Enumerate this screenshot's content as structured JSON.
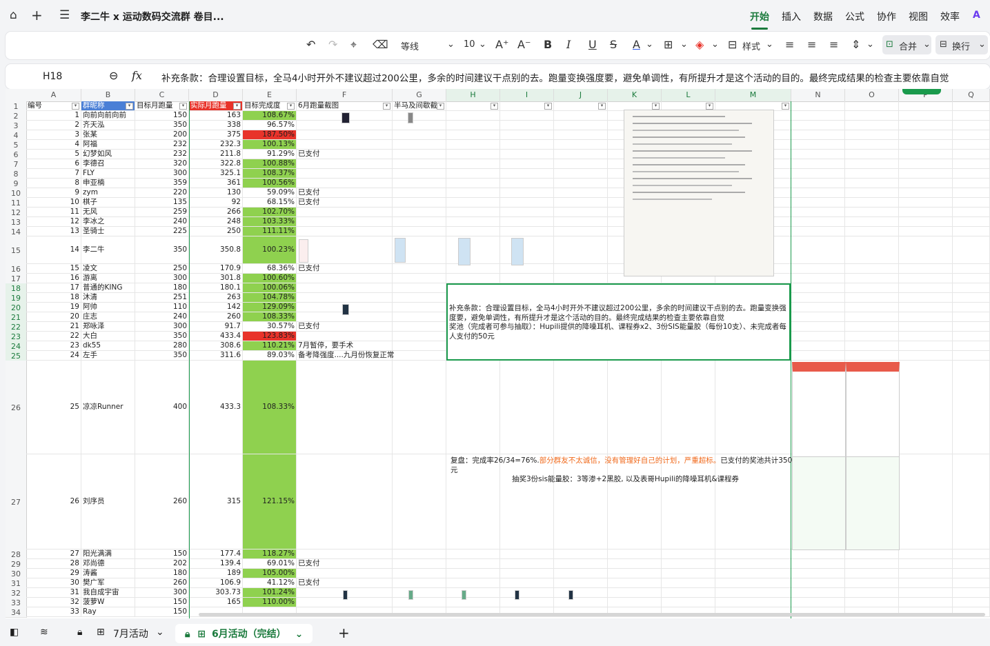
{
  "header": {
    "title": "李二牛 x 运动数码交流群 卷目...",
    "menus": [
      "开始",
      "插入",
      "数据",
      "公式",
      "协作",
      "视图",
      "效率"
    ]
  },
  "toolbar": {
    "font": "等线",
    "size": "10",
    "style_label": "样式",
    "merge_label": "合并",
    "wrap_label": "换行"
  },
  "formula_bar": {
    "cell": "H18",
    "content": "补充条款：合理设置目标，全马4小时开外不建议超过200公里，多余的时间建议干点别的去。跑量变换强度要，避免单调性，有所提升才是这个活动的目的。最终完成结果的检查主要依靠自觉"
  },
  "columns": [
    "A",
    "B",
    "C",
    "D",
    "E",
    "F",
    "G",
    "H",
    "I",
    "J",
    "K",
    "L",
    "M",
    "N",
    "O",
    "P",
    "Q"
  ],
  "table_headers": [
    "编号",
    "群昵称",
    "目标月跑量",
    "实际月跑量",
    "目标完成度",
    "6月跑量截图",
    "半马及间歇截"
  ],
  "rows": [
    {
      "r": "2",
      "no": "1",
      "name": "向前向前向前",
      "target": "150",
      "actual": "163",
      "pct": "108.67%",
      "c": "g",
      "note": ""
    },
    {
      "r": "3",
      "no": "2",
      "name": "齐天泓",
      "target": "350",
      "actual": "338",
      "pct": "96.57%",
      "c": "",
      "note": ""
    },
    {
      "r": "4",
      "no": "3",
      "name": "张某",
      "target": "200",
      "actual": "375",
      "pct": "187.50%",
      "c": "r",
      "note": ""
    },
    {
      "r": "5",
      "no": "4",
      "name": "阿福",
      "target": "232",
      "actual": "232.3",
      "pct": "100.13%",
      "c": "g",
      "note": ""
    },
    {
      "r": "6",
      "no": "5",
      "name": "幻梦如风",
      "target": "232",
      "actual": "211.8",
      "pct": "91.29%",
      "c": "",
      "note": "已支付"
    },
    {
      "r": "7",
      "no": "6",
      "name": "李德召",
      "target": "320",
      "actual": "322.8",
      "pct": "100.88%",
      "c": "g",
      "note": ""
    },
    {
      "r": "8",
      "no": "7",
      "name": "FLY",
      "target": "300",
      "actual": "325.1",
      "pct": "108.37%",
      "c": "g",
      "note": ""
    },
    {
      "r": "9",
      "no": "8",
      "name": "申亚楠",
      "target": "359",
      "actual": "361",
      "pct": "100.56%",
      "c": "g",
      "note": ""
    },
    {
      "r": "10",
      "no": "9",
      "name": "zym",
      "target": "220",
      "actual": "130",
      "pct": "59.09%",
      "c": "",
      "note": "已支付"
    },
    {
      "r": "11",
      "no": "10",
      "name": "棋子",
      "target": "135",
      "actual": "92",
      "pct": "68.15%",
      "c": "",
      "note": "已支付"
    },
    {
      "r": "12",
      "no": "11",
      "name": "无风",
      "target": "259",
      "actual": "266",
      "pct": "102.70%",
      "c": "g",
      "note": ""
    },
    {
      "r": "13",
      "no": "12",
      "name": "李冰之",
      "target": "240",
      "actual": "248",
      "pct": "103.33%",
      "c": "g",
      "note": ""
    },
    {
      "r": "14",
      "no": "13",
      "name": "圣骑士",
      "target": "225",
      "actual": "250",
      "pct": "111.11%",
      "c": "g",
      "note": ""
    },
    {
      "r": "15",
      "no": "14",
      "name": "李二牛",
      "target": "350",
      "actual": "350.8",
      "pct": "100.23%",
      "c": "g",
      "note": ""
    },
    {
      "r": "16",
      "no": "15",
      "name": "凌文",
      "target": "250",
      "actual": "170.9",
      "pct": "68.36%",
      "c": "",
      "note": "已支付"
    },
    {
      "r": "17",
      "no": "16",
      "name": "游离",
      "target": "300",
      "actual": "301.8",
      "pct": "100.60%",
      "c": "g",
      "note": ""
    },
    {
      "r": "18",
      "no": "17",
      "name": "普通的KING",
      "target": "180",
      "actual": "180.1",
      "pct": "100.06%",
      "c": "g",
      "note": ""
    },
    {
      "r": "19",
      "no": "18",
      "name": "沐清",
      "target": "251",
      "actual": "263",
      "pct": "104.78%",
      "c": "g",
      "note": ""
    },
    {
      "r": "20",
      "no": "19",
      "name": "阿帅",
      "target": "110",
      "actual": "142",
      "pct": "129.09%",
      "c": "g",
      "note": ""
    },
    {
      "r": "21",
      "no": "20",
      "name": "庄志",
      "target": "240",
      "actual": "260",
      "pct": "108.33%",
      "c": "g",
      "note": ""
    },
    {
      "r": "22",
      "no": "21",
      "name": "郑咏泽",
      "target": "300",
      "actual": "91.7",
      "pct": "30.57%",
      "c": "",
      "note": "已支付"
    },
    {
      "r": "23",
      "no": "22",
      "name": "大白",
      "target": "350",
      "actual": "433.4",
      "pct": "123.83%",
      "c": "r",
      "note": ""
    },
    {
      "r": "24",
      "no": "23",
      "name": "dk55",
      "target": "280",
      "actual": "308.6",
      "pct": "110.21%",
      "c": "g",
      "note": "7月暂停，要手术"
    },
    {
      "r": "25",
      "no": "24",
      "name": "左手",
      "target": "350",
      "actual": "311.6",
      "pct": "89.03%",
      "c": "",
      "note": "备考降强度....九月份恢复正常"
    },
    {
      "r": "26",
      "no": "25",
      "name": "凉凉Runner",
      "target": "400",
      "actual": "433.3",
      "pct": "108.33%",
      "c": "g",
      "note": ""
    },
    {
      "r": "27",
      "no": "26",
      "name": "刘序员",
      "target": "260",
      "actual": "315",
      "pct": "121.15%",
      "c": "g",
      "note": ""
    },
    {
      "r": "28",
      "no": "27",
      "name": "阳光满满",
      "target": "150",
      "actual": "177.4",
      "pct": "118.27%",
      "c": "g",
      "note": ""
    },
    {
      "r": "29",
      "no": "28",
      "name": "邓尚德",
      "target": "202",
      "actual": "139.4",
      "pct": "69.01%",
      "c": "",
      "note": "已支付"
    },
    {
      "r": "30",
      "no": "29",
      "name": "涛酱",
      "target": "180",
      "actual": "189",
      "pct": "105.00%",
      "c": "g",
      "note": ""
    },
    {
      "r": "31",
      "no": "30",
      "name": "樊广军",
      "target": "260",
      "actual": "106.9",
      "pct": "41.12%",
      "c": "",
      "note": "已支付"
    },
    {
      "r": "32",
      "no": "31",
      "name": "我自成宇宙",
      "target": "300",
      "actual": "303.73",
      "pct": "101.24%",
      "c": "g",
      "note": ""
    },
    {
      "r": "33",
      "no": "32",
      "name": "菠萝W",
      "target": "150",
      "actual": "165",
      "pct": "110.00%",
      "c": "g",
      "note": ""
    },
    {
      "r": "34",
      "no": "33",
      "name": "Ray",
      "target": "150",
      "actual": "",
      "pct": "",
      "c": "",
      "note": ""
    }
  ],
  "merged_note": {
    "line1": "补充条款：合理设置目标，全马4小时开外不建议超过200公里，多余的时间建议干点别的去。跑量变换强度要，避免单调性，有所提升才是这个活动的目的。最终完成结果的检查主要依靠自觉",
    "line2": "奖池（完成者可参与抽取）：Hupili提供的降噪耳机、课程券x2、3份SIS能量胶（每份10支）、未完成者每人支付的50元"
  },
  "review": {
    "prefix": "复盘：完成率26/34=76%.",
    "highlight": "部分群友不太诚信，没有管理好自己的计划，严重超标。",
    "suffix": "已支付的奖池共计350元",
    "line2": "抽奖3份sis能量胶：3等渗+2黑胶, 以及表哥Hupili的降噪耳机&课程券"
  },
  "sheets": [
    "7月活动",
    "6月活动（完结）"
  ],
  "colors": {
    "accent": "#1a7a3c",
    "green_fill": "#8fd14f",
    "red_fill": "#e8332a",
    "orange_text": "#f06a1c"
  }
}
